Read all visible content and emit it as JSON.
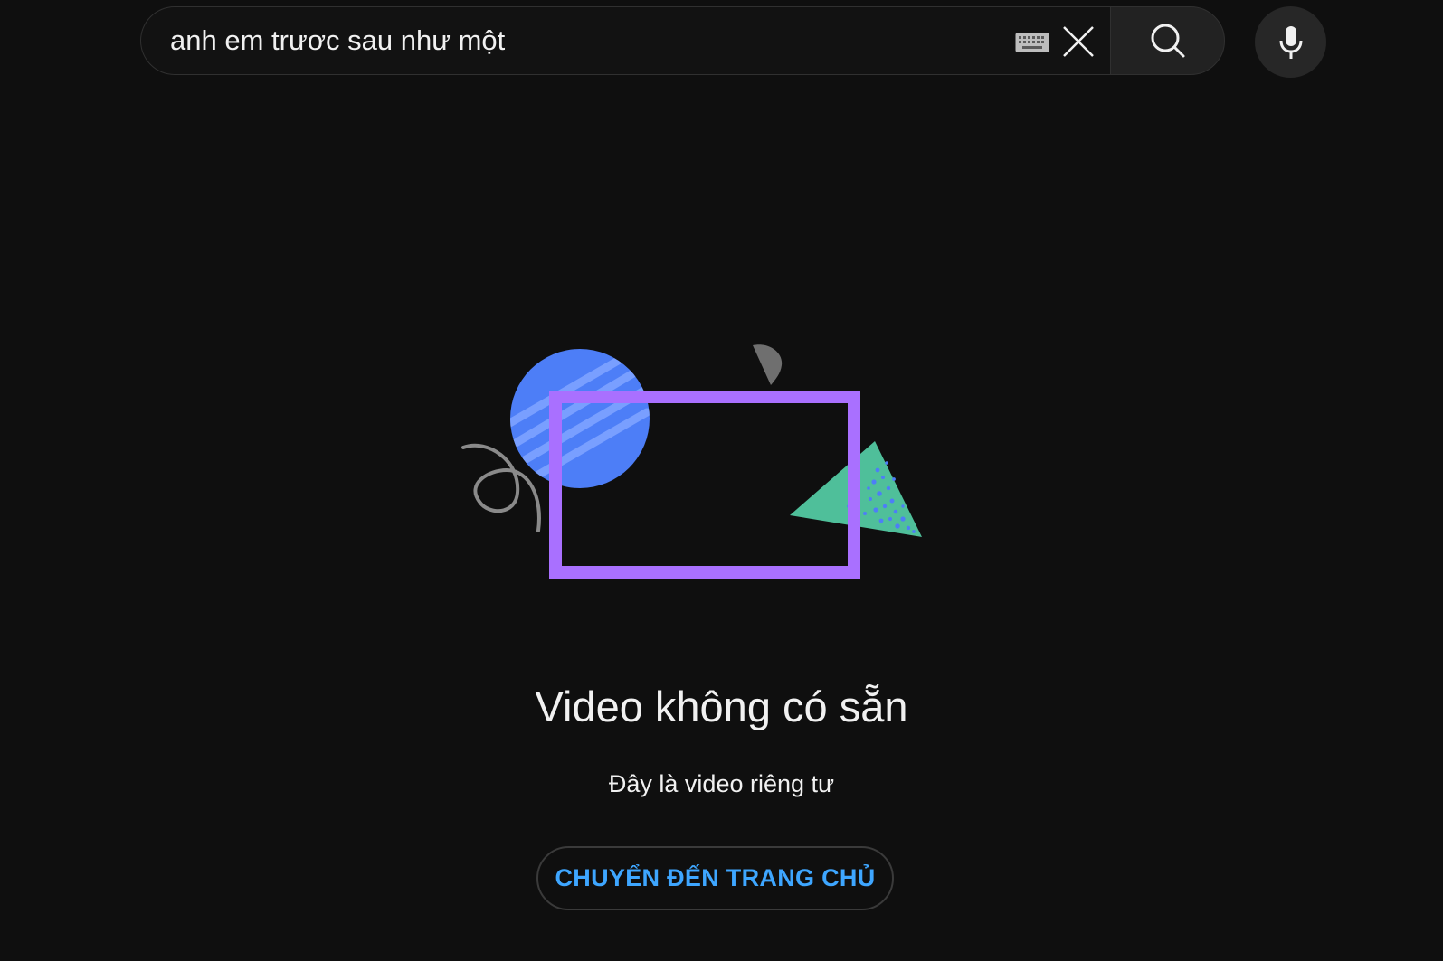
{
  "search": {
    "value": "anh em trươc sau như một",
    "keyboard_icon": "keyboard-icon",
    "clear_icon": "close-icon",
    "search_icon": "search-icon",
    "mic_icon": "mic-icon"
  },
  "message": {
    "title": "Video không có sẵn",
    "subtitle": "Đây là video riêng tư",
    "home_button_label": "CHUYỂN ĐẾN TRANG CHỦ"
  },
  "colors": {
    "background": "#0f0f0f",
    "link_blue": "#3ea6ff",
    "frame_purple": "#a970ff",
    "circle_blue": "#4d7ef7",
    "triangle_teal": "#4fbf9a"
  }
}
